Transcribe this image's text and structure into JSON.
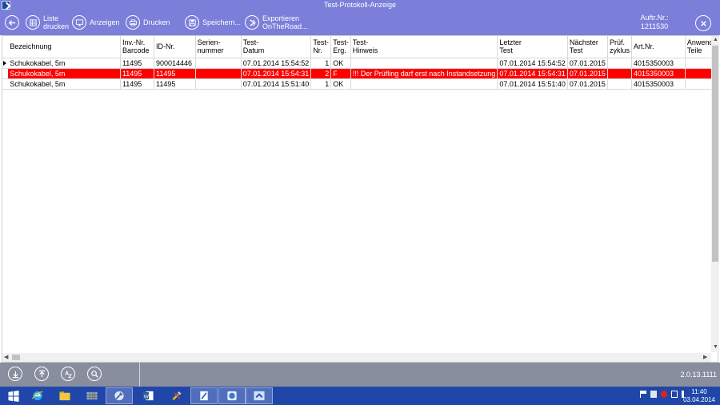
{
  "window": {
    "title": "Test-Protokoll-Anzeige"
  },
  "toolbar": {
    "liste_drucken": "Liste\ndrucken",
    "anzeigen": "Anzeigen",
    "drucken": "Drucken",
    "speichern": "Speichern...",
    "exportieren": "Exportieren\nOnTheRoad...",
    "auftr_label": "Auftr.Nr.:",
    "auftr_value": "1211530"
  },
  "table": {
    "headers": [
      "Bezeichnung",
      "Inv.-Nr.\nBarcode",
      "ID-Nr.",
      "Serien-\nnummer",
      "Test-\nDatum",
      "Test-\nNr.",
      "Test-\nErg.",
      "Test-\nHinweis",
      "Letzter\nTest",
      "Nächster\nTest",
      "Prüf.\nzyklus",
      "Art.Nr.",
      "Anwend.\nTeile"
    ],
    "rows": [
      [
        "Schukokabel, 5m",
        "11495",
        "900014446",
        "",
        "07.01.2014 15:54:52",
        "1",
        "OK",
        "",
        "07.01.2014 15:54:52",
        "07.01.2015",
        "",
        "4015350003",
        ""
      ],
      [
        "Schukokabel, 5m",
        "11495",
        "11495",
        "",
        "07.01.2014 15:54:31",
        "2",
        "F",
        "!!! Der Prüfling darf erst nach Instandsetzung",
        "07.01.2014 15:54:31",
        "07.01.2015",
        "",
        "4015350003",
        ""
      ],
      [
        "Schukokabel, 5m",
        "11495",
        "11495",
        "",
        "07.01.2014 15:51:40",
        "1",
        "OK",
        "",
        "07.01.2014 15:51:40",
        "07.01.2015",
        "",
        "4015350003",
        ""
      ]
    ]
  },
  "status": {
    "version": "2.0.13.1111"
  },
  "clock": {
    "time": "11:40",
    "date": "03.04.2014"
  },
  "colors": {
    "accent": "#7b7fd9",
    "error_row": "#ff0000",
    "taskbar": "#1f46a8"
  }
}
